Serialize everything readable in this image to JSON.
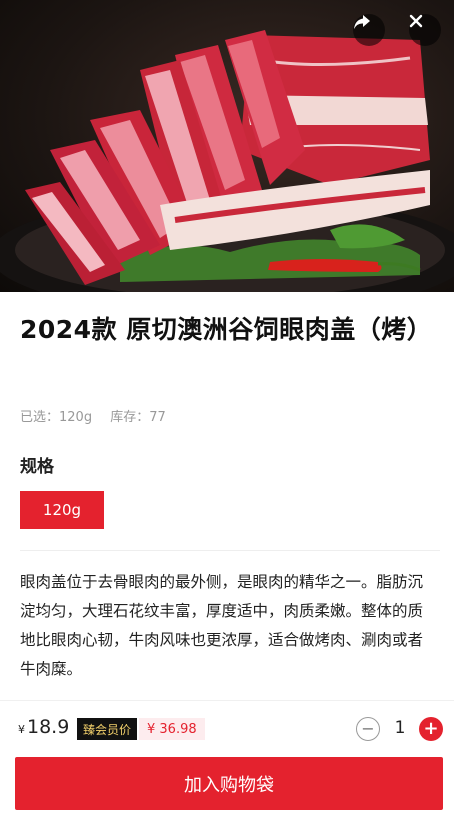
{
  "product": {
    "title": "2024款 原切澳洲谷饲眼肉盖（烤）",
    "selected_label": "已选：120g",
    "stock_label": "库存：77",
    "spec_heading": "规格",
    "spec_options": [
      "120g"
    ],
    "description": "眼肉盖位于去骨眼肉的最外侧，是眼肉的精华之一。脂肪沉淀均匀，大理石花纹丰富，厚度适中，肉质柔嫩。整体的质地比眼肉心韧，牛肉风味也更浓厚，适合做烤肉、涮肉或者牛肉糜。"
  },
  "pricing": {
    "currency_symbol": "¥",
    "price": "18.9",
    "member_badge": "臻会员价",
    "member_price": "¥ 36.98"
  },
  "quantity": {
    "value": "1",
    "minus": "−",
    "plus": "+"
  },
  "actions": {
    "add_to_cart": "加入购物袋"
  },
  "icons": {
    "share": "share-icon",
    "close": "close-icon"
  },
  "colors": {
    "accent": "#e4222e",
    "badge_bg": "#111111",
    "badge_text": "#f2d06b"
  }
}
